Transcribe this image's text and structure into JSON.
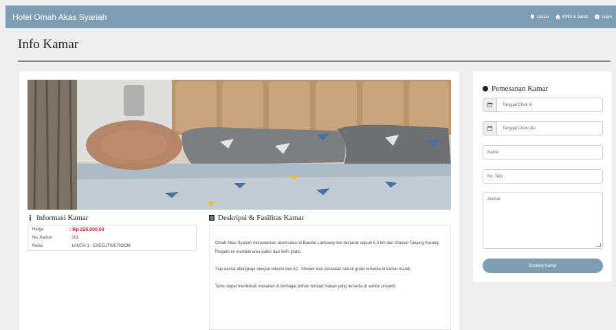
{
  "navbar": {
    "brand": "Hotel Omah Akas Syariah",
    "links": [
      {
        "label": "Lokasi",
        "icon": "map-marker-icon"
      },
      {
        "label": "KMM & Saran",
        "icon": "home-icon"
      },
      {
        "label": "Login",
        "icon": "info-icon"
      }
    ]
  },
  "page": {
    "title": "Info Kamar"
  },
  "info": {
    "title": "Informasi Kamar",
    "rows": [
      {
        "label": "Harga",
        "value": ": Rp 225.000,00"
      },
      {
        "label": "No. Kamar",
        "value": ": 101"
      },
      {
        "label": "Kelas",
        "value": ": LANTAI 1 - EXECUTIVE ROOM"
      }
    ]
  },
  "description": {
    "title": "Deskripsi & Fasilitas Kamar",
    "paragraphs": [
      "Omah Akas Syariah menawarkan akomodasi di Bandar Lampung dan berjarak sejauh 5,3 km dari Stasiun Tanjung Karang. Properti ini memiliki area parkir dan WiFi gratis.",
      "Tiap kamar dilengkapi dengan televisi dan AC. Shower dan peralatan mandi gratis tersedia di kamar mandi.",
      "Tamu dapat menikmati makanan di berbagai pilihan tempat makan yang tersedia di sekitar properti."
    ]
  },
  "booking": {
    "title": "Pemesanan Kamar",
    "checkin_placeholder": "Tanggal Chek In",
    "checkout_placeholder": "Tanggal Chek Out",
    "name_placeholder": "Nama",
    "phone_placeholder": "No. Telp",
    "address_placeholder": "Alamat",
    "button_label": "Booking Kamar"
  },
  "colors": {
    "navbar": "#7f9db1",
    "price": "#c0262d",
    "button": "#7f9db1"
  }
}
